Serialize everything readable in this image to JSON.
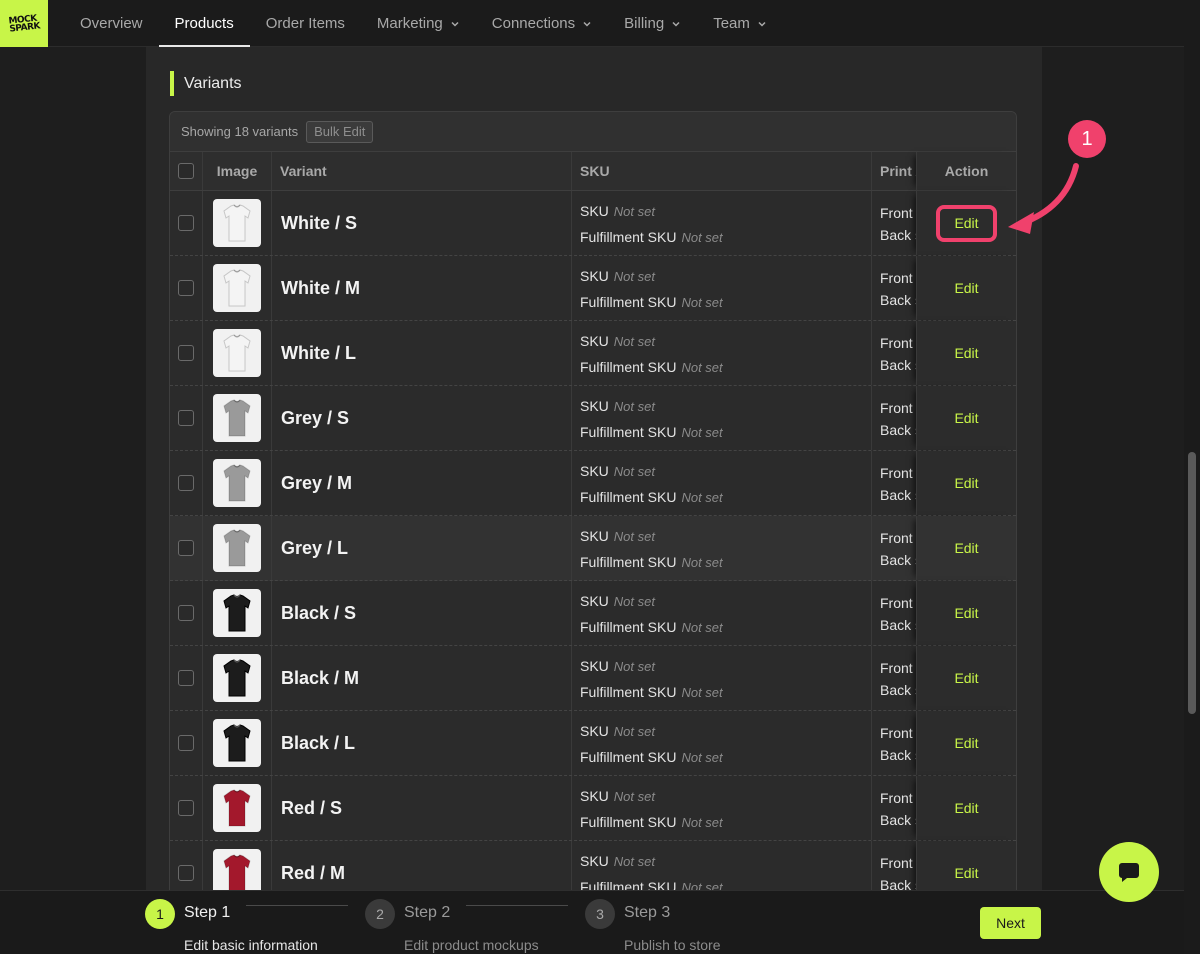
{
  "brand": {
    "logo_text": "MOCK SPARK",
    "accent": "#c8f548",
    "annotation_color": "#f0416c"
  },
  "nav": {
    "items": [
      {
        "label": "Overview",
        "dropdown": false,
        "active": false
      },
      {
        "label": "Products",
        "dropdown": false,
        "active": true
      },
      {
        "label": "Order Items",
        "dropdown": false,
        "active": false
      },
      {
        "label": "Marketing",
        "dropdown": true,
        "active": false
      },
      {
        "label": "Connections",
        "dropdown": true,
        "active": false
      },
      {
        "label": "Billing",
        "dropdown": true,
        "active": false
      },
      {
        "label": "Team",
        "dropdown": true,
        "active": false
      }
    ]
  },
  "section": {
    "title": "Variants"
  },
  "table": {
    "showing_text": "Showing 18 variants",
    "bulk_edit_label": "Bulk Edit",
    "columns": [
      "Image",
      "Variant",
      "SKU",
      "Print Areas",
      "Action"
    ],
    "sku_label": "SKU",
    "fulfillment_sku_label": "Fulfillment SKU",
    "not_set": "Not set",
    "print_front": "Front",
    "print_back": "Back side",
    "edit_label": "Edit",
    "rows": [
      {
        "variant": "White / S",
        "shirt_color": "#f4f4f4"
      },
      {
        "variant": "White / M",
        "shirt_color": "#f4f4f4"
      },
      {
        "variant": "White / L",
        "shirt_color": "#f4f4f4"
      },
      {
        "variant": "Grey / S",
        "shirt_color": "#9a9a9a"
      },
      {
        "variant": "Grey / M",
        "shirt_color": "#9a9a9a"
      },
      {
        "variant": "Grey / L",
        "shirt_color": "#9a9a9a"
      },
      {
        "variant": "Black / S",
        "shirt_color": "#1c1c1c"
      },
      {
        "variant": "Black / M",
        "shirt_color": "#1c1c1c"
      },
      {
        "variant": "Black / L",
        "shirt_color": "#1c1c1c"
      },
      {
        "variant": "Red / S",
        "shirt_color": "#a3182c"
      },
      {
        "variant": "Red / M",
        "shirt_color": "#a3182c"
      }
    ]
  },
  "annotation": {
    "badge": "1"
  },
  "stepper": {
    "steps": [
      {
        "number": "1",
        "title": "Step 1",
        "desc": "Edit basic information",
        "active": true
      },
      {
        "number": "2",
        "title": "Step 2",
        "desc": "Edit product mockups",
        "active": false
      },
      {
        "number": "3",
        "title": "Step 3",
        "desc": "Publish to store",
        "active": false
      }
    ],
    "next_label": "Next"
  }
}
